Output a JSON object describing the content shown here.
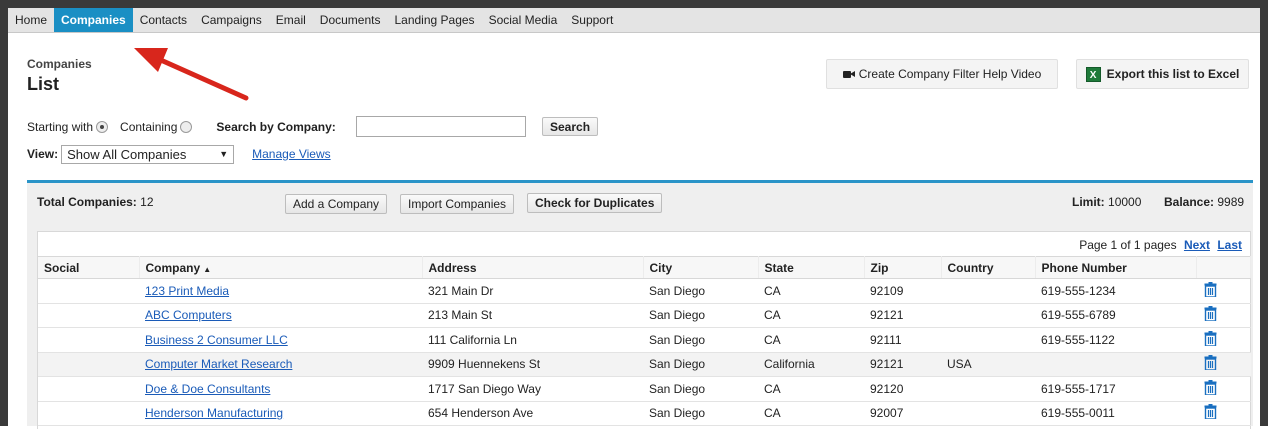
{
  "nav": {
    "tabs": [
      "Home",
      "Companies",
      "Contacts",
      "Campaigns",
      "Email",
      "Documents",
      "Landing Pages",
      "Social Media",
      "Support"
    ],
    "active": "Companies"
  },
  "header": {
    "breadcrumb": "Companies",
    "title": "List",
    "video_button": "Create Company Filter Help Video",
    "excel_button": "Export this list to Excel",
    "excel_icon_text": "X"
  },
  "filter": {
    "starting_with": "Starting with",
    "containing": "Containing",
    "selected": "starting_with",
    "search_label": "Search by Company:",
    "search_value": "",
    "search_button": "Search",
    "view_label": "View:",
    "view_value": "Show All Companies",
    "manage_views": "Manage Views"
  },
  "panel": {
    "total_label": "Total Companies:",
    "total_value": "12",
    "add_button": "Add a Company",
    "import_button": "Import Companies",
    "duplicates_button": "Check for Duplicates",
    "limit_label": "Limit:",
    "limit_value": "10000",
    "balance_label": "Balance:",
    "balance_value": "9989",
    "pager_text": "Page 1 of 1 pages",
    "next": "Next",
    "last": "Last"
  },
  "table": {
    "columns": [
      "Social",
      "Company",
      "Address",
      "City",
      "State",
      "Zip",
      "Country",
      "Phone Number"
    ],
    "sort_indicator": "▲",
    "rows": [
      {
        "company": "123 Print Media",
        "address": "321 Main Dr",
        "city": "San Diego",
        "state": "CA",
        "zip": "92109",
        "country": "",
        "phone": "619-555-1234"
      },
      {
        "company": "ABC Computers",
        "address": "213 Main St",
        "city": "San Diego",
        "state": "CA",
        "zip": "92121",
        "country": "",
        "phone": "619-555-6789"
      },
      {
        "company": "Business 2 Consumer LLC",
        "address": "111 California Ln",
        "city": "San Diego",
        "state": "CA",
        "zip": "92111",
        "country": "",
        "phone": "619-555-1122"
      },
      {
        "company": "Computer Market Research",
        "address": "9909 Huennekens St",
        "city": "San Diego",
        "state": "California",
        "zip": "92121",
        "country": "USA",
        "phone": ""
      },
      {
        "company": "Doe & Doe Consultants",
        "address": "1717 San Diego Way",
        "city": "San Diego",
        "state": "CA",
        "zip": "92120",
        "country": "",
        "phone": "619-555-1717"
      },
      {
        "company": "Henderson Manufacturing",
        "address": "654 Henderson Ave",
        "city": "San Diego",
        "state": "CA",
        "zip": "92007",
        "country": "",
        "phone": "619-555-0011"
      }
    ]
  },
  "colors": {
    "accent": "#1a8fc4",
    "panel_border": "#2a94c8",
    "link": "#1a5bb8",
    "arrow": "#d8261c",
    "trash": "#1a6fc0"
  },
  "icons": {
    "video": "video-camera-icon",
    "excel": "excel-icon",
    "delete": "trash-icon",
    "pointer": "red-arrow-annotation"
  }
}
